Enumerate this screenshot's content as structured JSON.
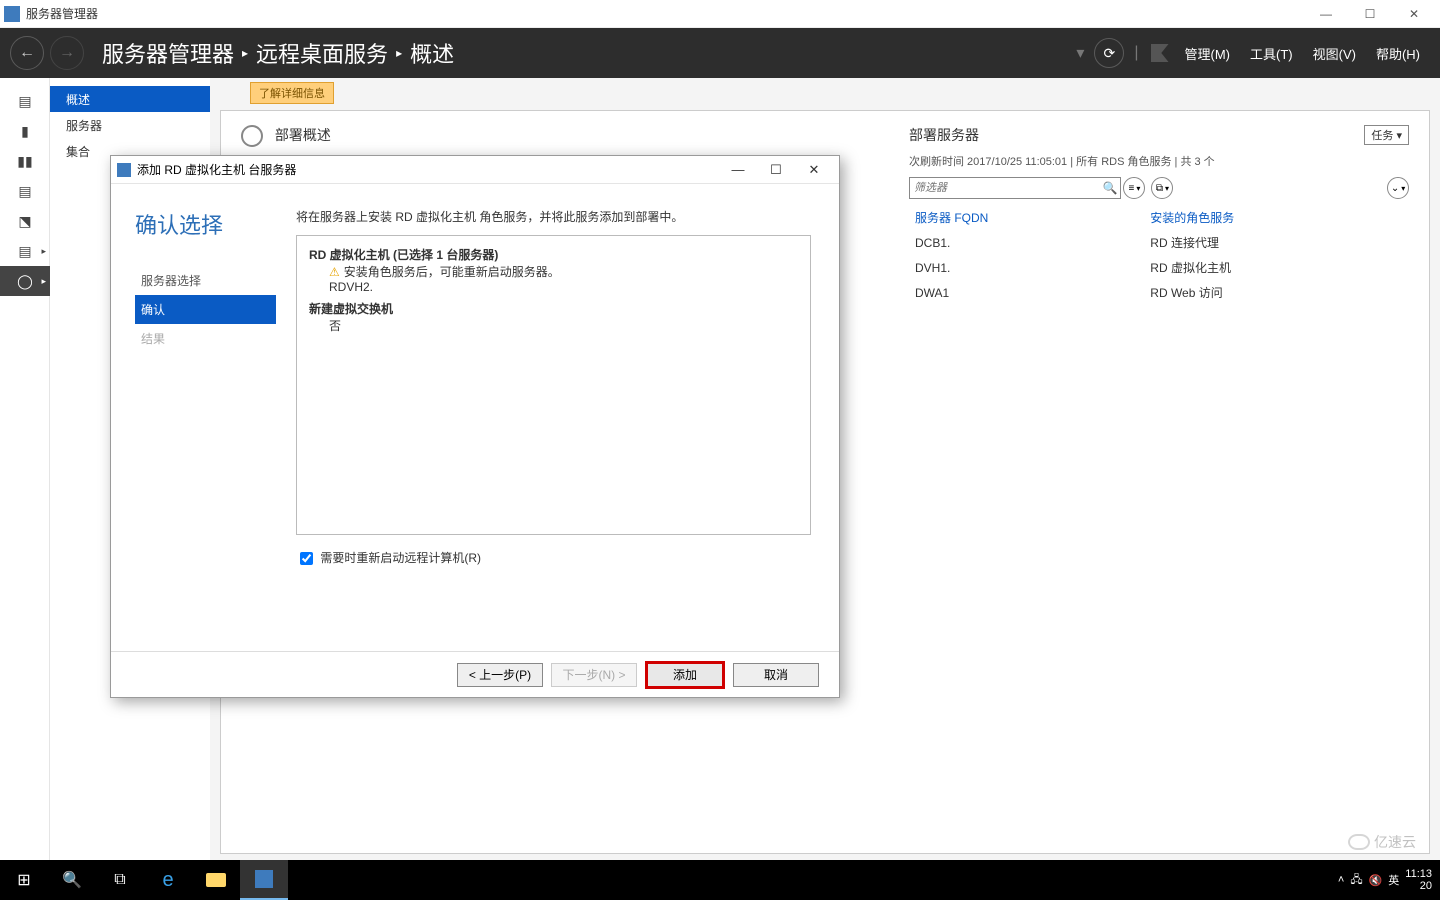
{
  "outer": {
    "title": "服务器管理器"
  },
  "win_controls": {
    "min": "—",
    "max": "☐",
    "close": "✕"
  },
  "header": {
    "breadcrumb": [
      "服务器管理器",
      "远程桌面服务",
      "概述"
    ],
    "menus": {
      "manage": "管理(M)",
      "tools": "工具(T)",
      "view": "视图(V)",
      "help": "帮助(H)"
    }
  },
  "sidebar": {
    "items": [
      {
        "label": "概述",
        "sel": true
      },
      {
        "label": "服务器"
      },
      {
        "label": "集合"
      }
    ]
  },
  "notice": "了解详细信息",
  "deployment": {
    "left_title": "部署概述",
    "right_title": "部署服务器",
    "tasks_label": "任务",
    "status": "次刷新时间 2017/10/25 11:05:01 | 所有 RDS 角色服务 | 共 3 个",
    "filter_placeholder": "筛选器",
    "view1": "≡",
    "view2": "⧉",
    "columns": {
      "fqdn": "服务器 FQDN",
      "role": "安装的角色服务"
    },
    "rows": [
      {
        "fqdn": "DCB1.",
        "role": "RD 连接代理"
      },
      {
        "fqdn": "DVH1.",
        "role": "RD 虚拟化主机"
      },
      {
        "fqdn": "DWA1",
        "role": "RD Web 访问"
      }
    ]
  },
  "dialog": {
    "title": "添加 RD 虚拟化主机 台服务器",
    "heading": "确认选择",
    "steps": [
      {
        "label": "服务器选择",
        "state": ""
      },
      {
        "label": "确认",
        "state": "active"
      },
      {
        "label": "结果",
        "state": "disabled"
      }
    ],
    "intro": "将在服务器上安装 RD 虚拟化主机 角色服务，并将此服务添加到部署中。",
    "summary": {
      "line1": "RD 虚拟化主机  (已选择 1 台服务器)",
      "line2": "安装角色服务后，可能重新启动服务器。",
      "line3": "RDVH2.",
      "line4": "新建虚拟交换机",
      "line5": "否"
    },
    "checkbox_label": "需要时重新启动远程计算机(R)",
    "buttons": {
      "prev": "< 上一步(P)",
      "next": "下一步(N) >",
      "add": "添加",
      "cancel": "取消"
    }
  },
  "taskbar": {
    "time": "11:13",
    "date": "20",
    "ime": "英",
    "watermark": "亿速云"
  }
}
